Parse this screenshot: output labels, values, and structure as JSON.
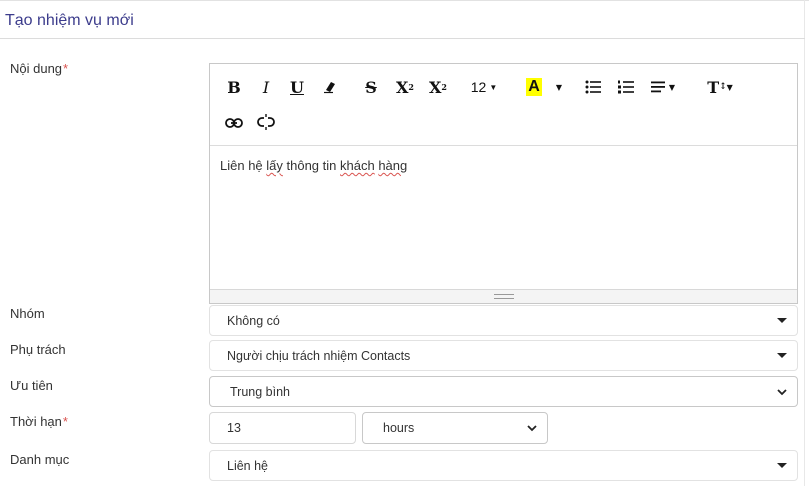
{
  "page": {
    "title": "Tạo nhiệm vụ mới"
  },
  "content": {
    "label": "Nội dung",
    "required_mark": "*",
    "text_plain_1": "Liên hệ ",
    "text_spell_1": "lấy",
    "text_plain_2": " thông tin ",
    "text_spell_2": "khách",
    "text_plain_3": " ",
    "text_spell_3": "hàng"
  },
  "toolbar": {
    "bold": "B",
    "italic": "I",
    "underline": "U",
    "strikethrough": "S",
    "superscript": "X",
    "superscript_mark": "2",
    "subscript": "X",
    "subscript_mark": "2",
    "font_size": "12",
    "highlight": "A",
    "highlight_color": "#ffff00",
    "text_size_icon": "T"
  },
  "group": {
    "label": "Nhóm",
    "value": "Không có"
  },
  "owner": {
    "label": "Phụ trách",
    "value": "Người chịu trách nhiệm Contacts"
  },
  "priority": {
    "label": "Ưu tiên",
    "value": "Trung bình"
  },
  "deadline": {
    "label": "Thời hạn",
    "required_mark": "*",
    "value": "13",
    "unit": "hours"
  },
  "category": {
    "label": "Danh mục",
    "value": "Liên hệ"
  },
  "colors": {
    "title": "#3c3c8c",
    "required": "#d9534f"
  }
}
